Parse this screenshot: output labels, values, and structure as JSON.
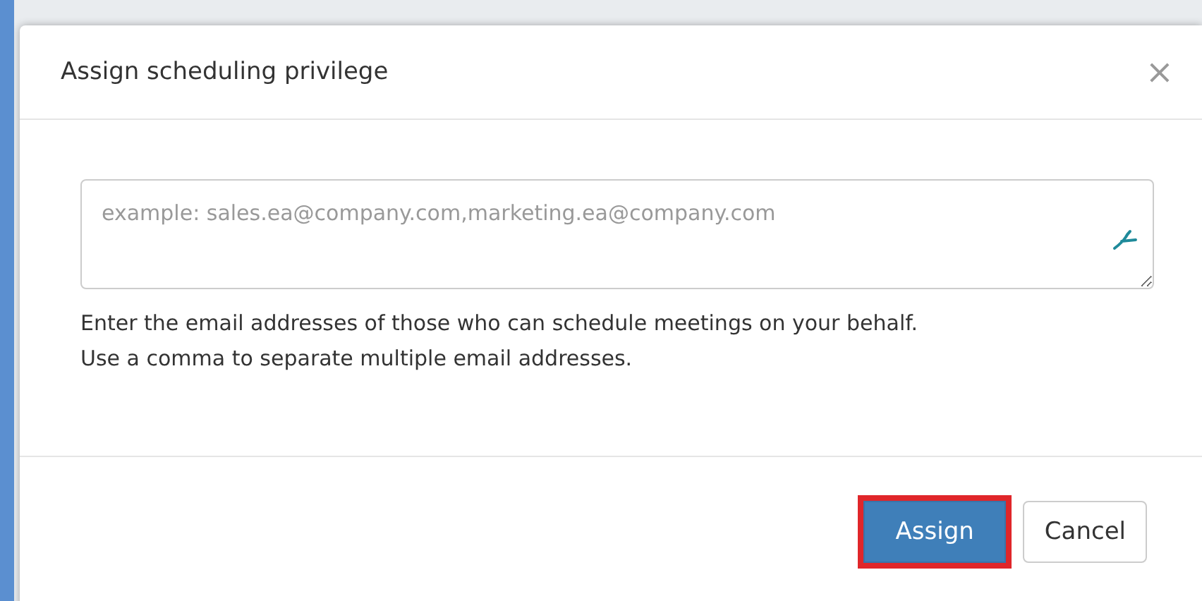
{
  "dialog": {
    "title": "Assign scheduling privilege",
    "close": "×",
    "email_field": {
      "placeholder": "example: sales.ea@company.com,marketing.ea@company.com"
    },
    "help_lines": [
      "Enter the email addresses of those who can schedule meetings on your behalf.",
      "Use a comma to separate multiple email addresses."
    ],
    "buttons": [
      {
        "label": "Assign",
        "kind": "primary",
        "highlighted": true
      },
      {
        "label": "Cancel",
        "kind": "default",
        "highlighted": false
      }
    ]
  }
}
